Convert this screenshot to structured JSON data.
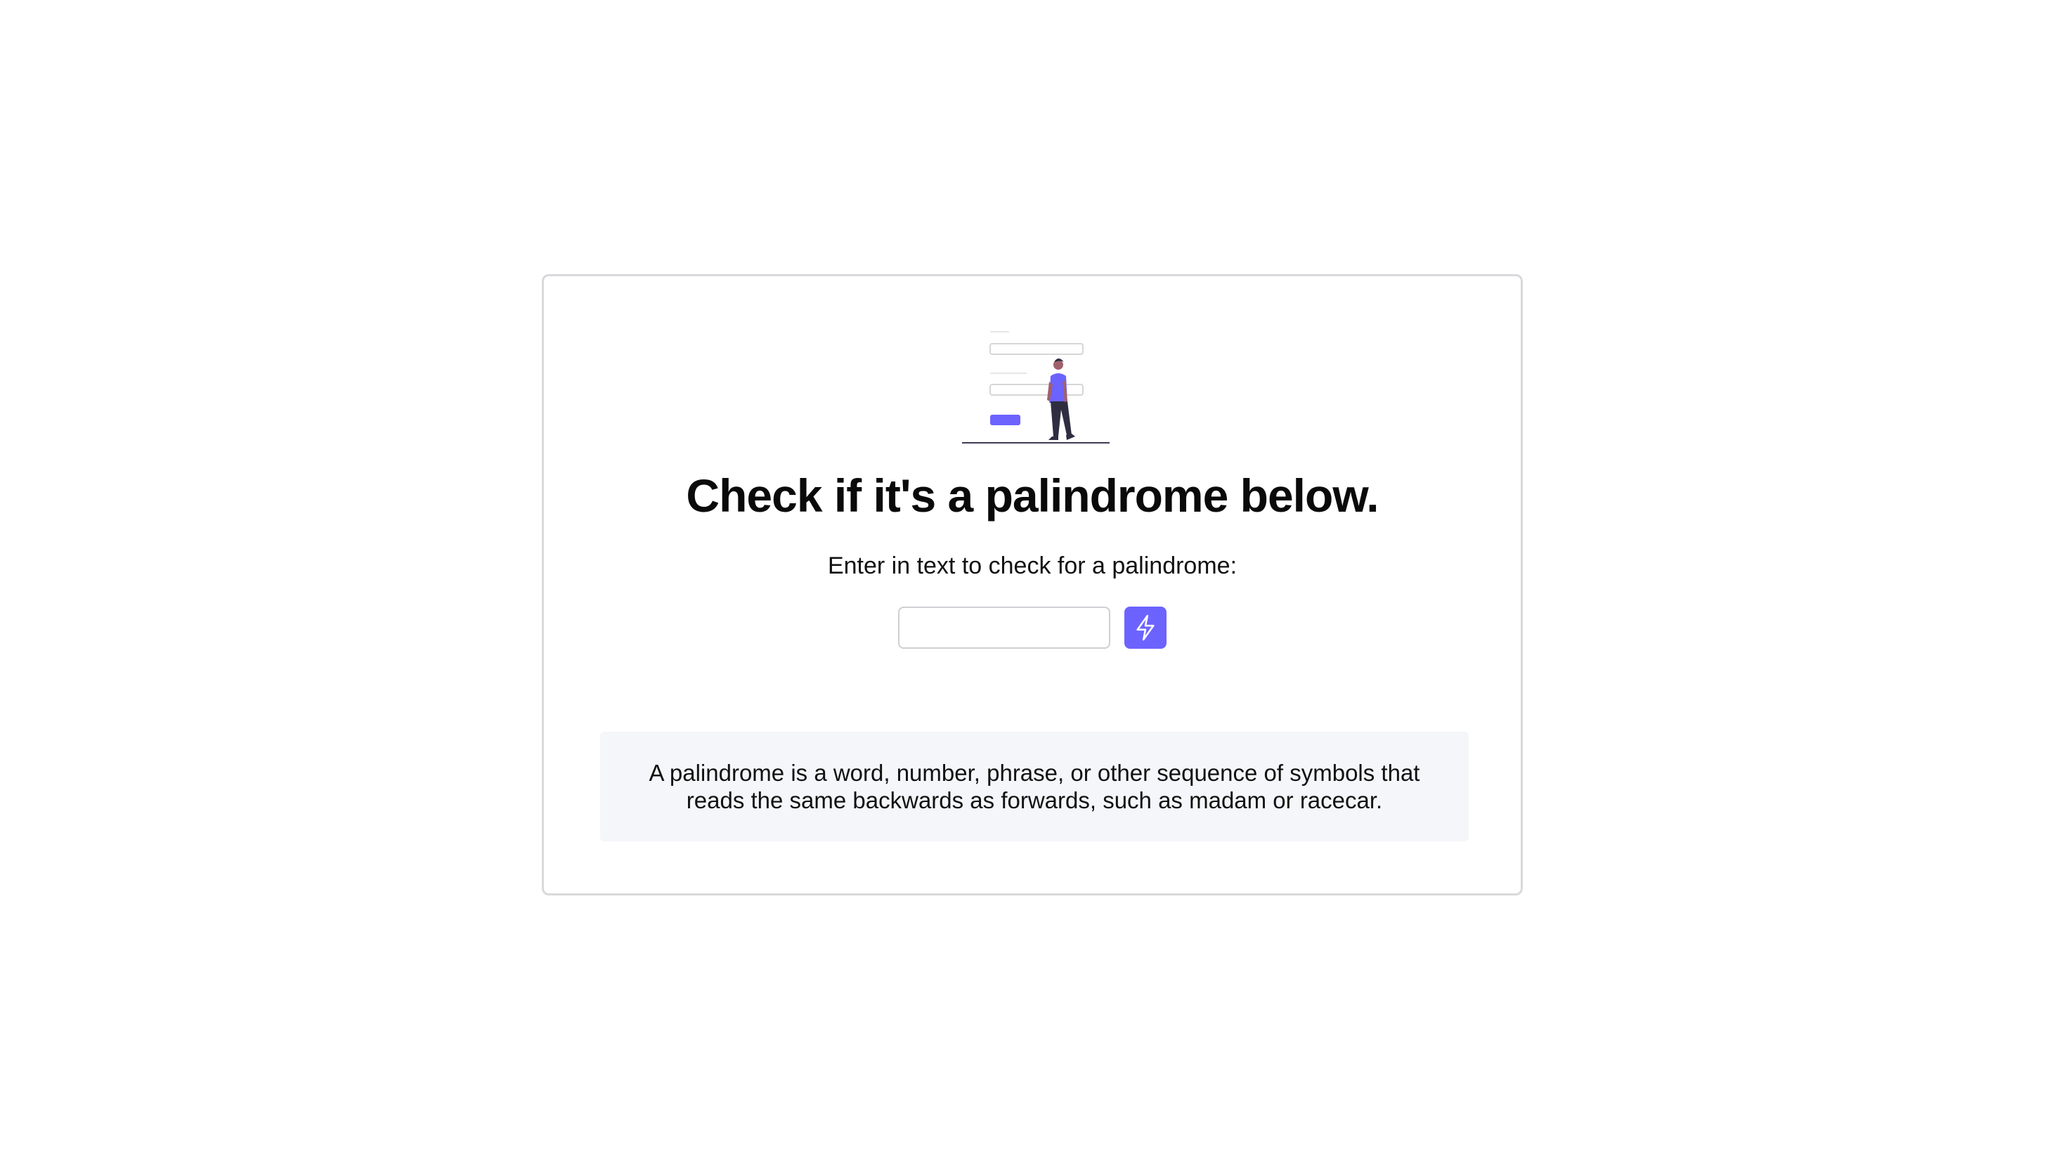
{
  "main": {
    "title": "Check if it's a palindrome below.",
    "prompt": "Enter in text to check for a palindrome:",
    "input": {
      "value": "",
      "placeholder": ""
    },
    "check_button_icon": "lightning-bolt-icon",
    "info": "A palindrome is a word, number, phrase, or other sequence of symbols that reads the same backwards as forwards, such as madam or racecar."
  },
  "colors": {
    "accent": "#6c63ff",
    "card_border": "#d9d9dc",
    "info_background": "#f4f6f9",
    "figure_pants": "#2f2e41",
    "figure_skin": "#a0616a"
  }
}
